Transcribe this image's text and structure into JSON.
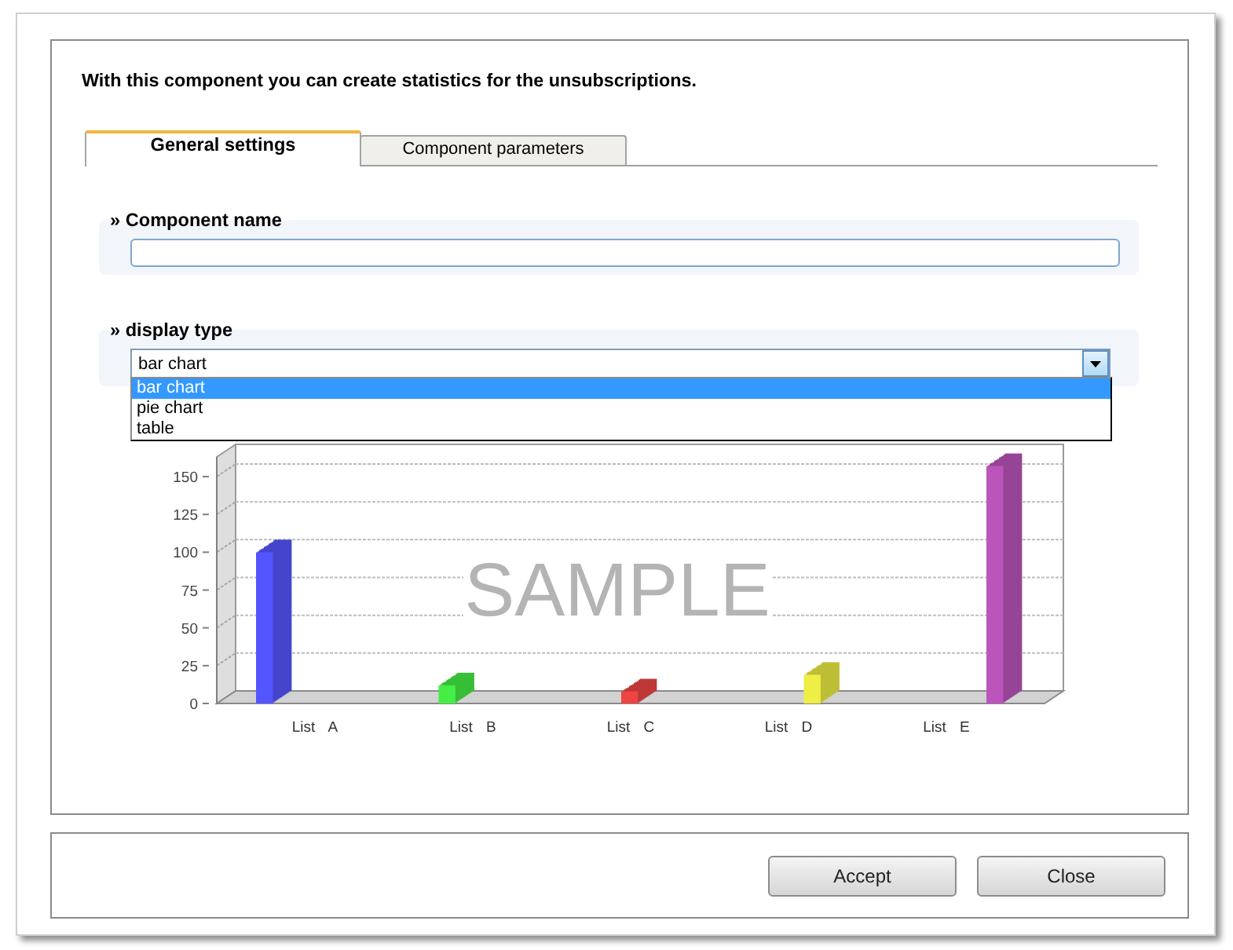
{
  "intro": "With this component you can create statistics for the unsubscriptions.",
  "tabs": [
    {
      "label": "General settings",
      "selected": true
    },
    {
      "label": "Component parameters",
      "selected": false
    }
  ],
  "component_name": {
    "label": "» Component name"
  },
  "display_type": {
    "label": "» display type",
    "value": "bar chart",
    "expanded": true,
    "options": [
      {
        "label": "bar chart",
        "selected": true
      },
      {
        "label": "pie chart",
        "selected": false
      },
      {
        "label": "table",
        "selected": false
      }
    ]
  },
  "preview": {
    "sample_label": "SAMPLE",
    "chart_data": {
      "type": "bar",
      "categories": [
        "List A",
        "List B",
        "List C",
        "List D",
        "List E"
      ],
      "series": [
        {
          "values": [
            100,
            12,
            8,
            19,
            157
          ],
          "colors": [
            "#5555ff",
            "#44ee44",
            "#ee4444",
            "#eeee44",
            "#bb55bb"
          ]
        }
      ],
      "ylim": [
        0,
        163
      ],
      "yticks": [
        0,
        25,
        50,
        75,
        100,
        125,
        150
      ]
    }
  },
  "buttons": [
    {
      "label": "Accept"
    },
    {
      "label": "Close"
    }
  ]
}
